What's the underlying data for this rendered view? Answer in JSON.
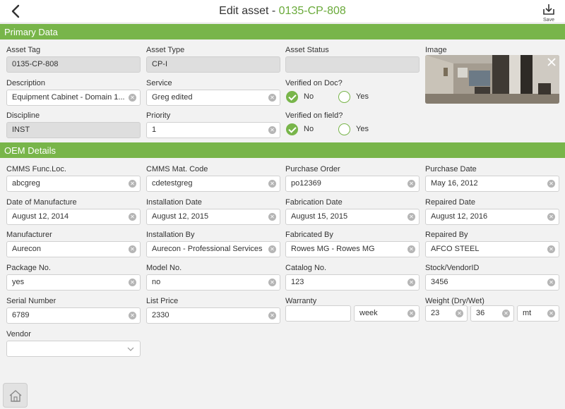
{
  "header": {
    "title_prefix": "Edit asset - ",
    "asset_code": "0135-CP-808",
    "save_label": "Save",
    "back_icon": "chevron-left-icon",
    "save_icon": "save-download-icon"
  },
  "sections": {
    "primary": "Primary Data",
    "oem": "OEM Details"
  },
  "primary": {
    "asset_tag": {
      "label": "Asset Tag",
      "value": "0135-CP-808"
    },
    "asset_type": {
      "label": "Asset Type",
      "value": "CP-I"
    },
    "asset_status": {
      "label": "Asset Status",
      "value": ""
    },
    "image": {
      "label": "Image"
    },
    "description": {
      "label": "Description",
      "value": "Equipment Cabinet - Domain 1..."
    },
    "service": {
      "label": "Service",
      "value": "Greg edited"
    },
    "verified_doc": {
      "label": "Verified on Doc?",
      "no": "No",
      "yes": "Yes",
      "selected": "No"
    },
    "discipline": {
      "label": "Discipline",
      "value": "INST"
    },
    "priority": {
      "label": "Priority",
      "value": "1"
    },
    "verified_field": {
      "label": "Verified on field?",
      "no": "No",
      "yes": "Yes",
      "selected": "No"
    }
  },
  "oem": {
    "cmms_func_loc": {
      "label": "CMMS Func.Loc.",
      "value": "abcgreg"
    },
    "cmms_mat_code": {
      "label": "CMMS Mat. Code",
      "value": "cdetestgreg"
    },
    "purchase_order": {
      "label": "Purchase Order",
      "value": "po12369"
    },
    "purchase_date": {
      "label": "Purchase Date",
      "value": "May 16, 2012"
    },
    "date_of_manufacture": {
      "label": "Date of Manufacture",
      "value": "August 12, 2014"
    },
    "installation_date": {
      "label": "Installation Date",
      "value": "August 12, 2015"
    },
    "fabrication_date": {
      "label": "Fabrication Date",
      "value": "August 15, 2015"
    },
    "repaired_date": {
      "label": "Repaired Date",
      "value": "August 12, 2016"
    },
    "manufacturer": {
      "label": "Manufacturer",
      "value": "Aurecon"
    },
    "installation_by": {
      "label": "Installation By",
      "value": "Aurecon - Professional Services"
    },
    "fabricated_by": {
      "label": "Fabricated By",
      "value": "Rowes MG - Rowes MG"
    },
    "repaired_by": {
      "label": "Repaired By",
      "value": "AFCO STEEL"
    },
    "package_no": {
      "label": "Package No.",
      "value": "yes"
    },
    "model_no": {
      "label": "Model No.",
      "value": "no"
    },
    "catalog_no": {
      "label": "Catalog No.",
      "value": "123"
    },
    "stock_vendor_id": {
      "label": "Stock/VendorID",
      "value": "3456"
    },
    "serial_number": {
      "label": "Serial Number",
      "value": "6789"
    },
    "list_price": {
      "label": "List Price",
      "value": "2330"
    },
    "warranty": {
      "label": "Warranty",
      "value": "",
      "unit": "week"
    },
    "weight": {
      "label": "Weight (Dry/Wet)",
      "dry": "23",
      "wet": "36",
      "unit": "mt"
    },
    "vendor": {
      "label": "Vendor",
      "value": ""
    }
  },
  "colors": {
    "accent": "#78b54a",
    "tag": "#6aaa3a"
  }
}
